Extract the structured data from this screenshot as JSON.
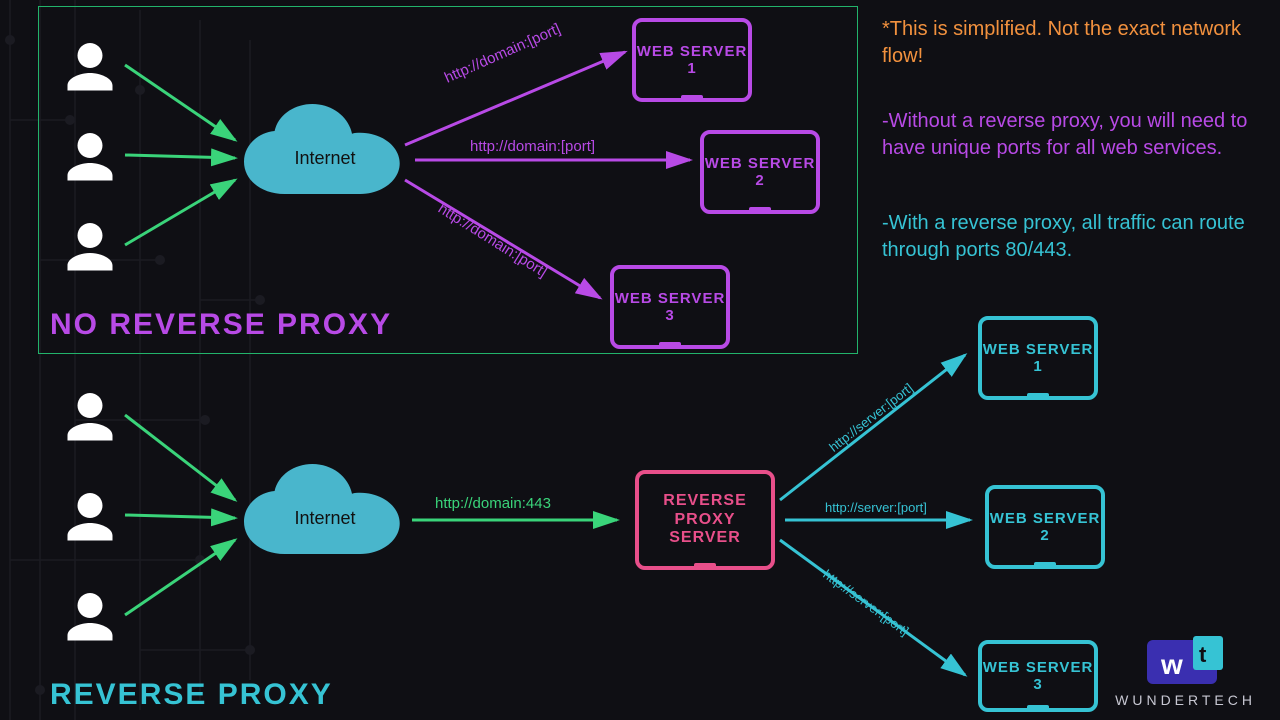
{
  "titles": {
    "no_proxy": "NO REVERSE PROXY",
    "with_proxy": "REVERSE PROXY"
  },
  "cloud_label": "Internet",
  "no_proxy": {
    "arrow_labels": [
      "http://domain:[port]",
      "http://domain:[port]",
      "http://domain:[port]"
    ],
    "servers": [
      "WEB SERVER 1",
      "WEB SERVER 2",
      "WEB SERVER 3"
    ]
  },
  "with_proxy": {
    "to_proxy_label": "http://domain:443",
    "proxy_box": "REVERSE PROXY SERVER",
    "backend_labels": [
      "http://server:[port]",
      "http://server:[port]",
      "http://server:[port]"
    ],
    "servers": [
      "WEB SERVER 1",
      "WEB SERVER 2",
      "WEB SERVER 3"
    ]
  },
  "notes": {
    "disclaimer": "*This is simplified. Not the exact network flow!",
    "line_without": "-Without a reverse proxy, you will need to have unique ports for all web services.",
    "line_with": "-With a reverse proxy, all traffic can route through ports 80/443."
  },
  "brand": "WUNDERTECH",
  "colors": {
    "purple": "#b84ae6",
    "cyan": "#36c3d4",
    "green": "#3ad47a",
    "pink": "#e84f8a",
    "cloud": "#49b6cc",
    "orange": "#f2913e"
  }
}
